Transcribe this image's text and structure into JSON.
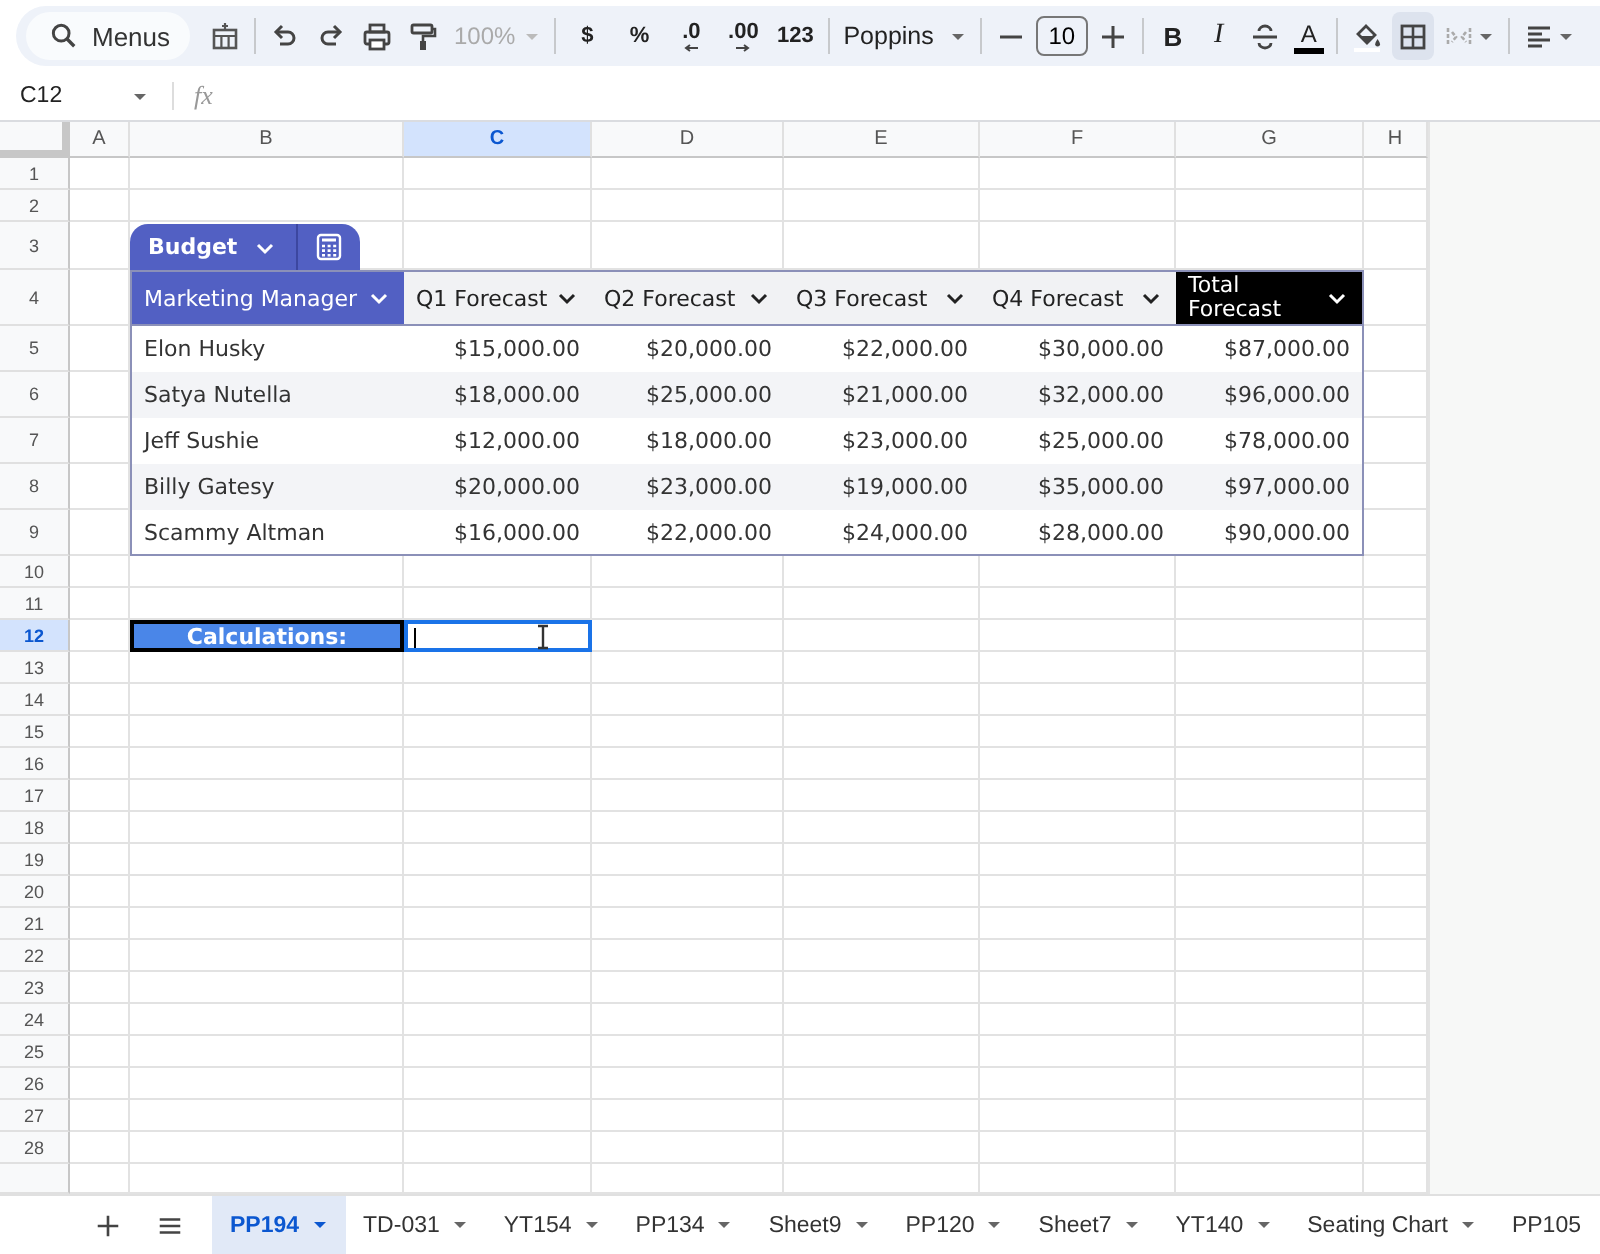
{
  "toolbar": {
    "search": {
      "placeholder": "Menus"
    },
    "zoom": {
      "value": "100%",
      "disabled": true
    },
    "format_buttons": [
      "$",
      "%",
      ".0",
      ".00",
      "123"
    ],
    "font": "Poppins",
    "font_size": "10",
    "bold": "B",
    "italic": "I",
    "text_color": "A",
    "borders": {
      "selected": true
    },
    "merge": {
      "disabled": true
    }
  },
  "formula_bar": {
    "name_box": "C12",
    "fx": "fx"
  },
  "columns": [
    {
      "label": "A",
      "selected": false
    },
    {
      "label": "B",
      "selected": false
    },
    {
      "label": "C",
      "selected": true
    },
    {
      "label": "D",
      "selected": false
    },
    {
      "label": "E",
      "selected": false
    },
    {
      "label": "F",
      "selected": false
    },
    {
      "label": "G",
      "selected": false
    },
    {
      "label": "H",
      "selected": false
    }
  ],
  "rows": [
    {
      "label": "1",
      "selected": false
    },
    {
      "label": "2",
      "selected": false
    },
    {
      "label": "3",
      "selected": false
    },
    {
      "label": "4",
      "selected": false
    },
    {
      "label": "5",
      "selected": false
    },
    {
      "label": "6",
      "selected": false
    },
    {
      "label": "7",
      "selected": false
    },
    {
      "label": "8",
      "selected": false
    },
    {
      "label": "9",
      "selected": false
    },
    {
      "label": "10",
      "selected": false
    },
    {
      "label": "11",
      "selected": false
    },
    {
      "label": "12",
      "selected": true
    },
    {
      "label": "13",
      "selected": false
    },
    {
      "label": "14",
      "selected": false
    },
    {
      "label": "15",
      "selected": false
    },
    {
      "label": "16",
      "selected": false
    },
    {
      "label": "17",
      "selected": false
    },
    {
      "label": "18",
      "selected": false
    },
    {
      "label": "19",
      "selected": false
    },
    {
      "label": "20",
      "selected": false
    },
    {
      "label": "21",
      "selected": false
    },
    {
      "label": "22",
      "selected": false
    },
    {
      "label": "23",
      "selected": false
    },
    {
      "label": "24",
      "selected": false
    },
    {
      "label": "25",
      "selected": false
    },
    {
      "label": "26",
      "selected": false
    },
    {
      "label": "27",
      "selected": false
    },
    {
      "label": "28",
      "selected": false
    }
  ],
  "table": {
    "name": "Budget",
    "headers": [
      {
        "label": "Marketing Manager",
        "kind": "accent"
      },
      {
        "label": "Q1 Forecast",
        "kind": "plain"
      },
      {
        "label": "Q2 Forecast",
        "kind": "plain"
      },
      {
        "label": "Q3 Forecast",
        "kind": "plain"
      },
      {
        "label": "Q4 Forecast",
        "kind": "plain"
      },
      {
        "label": "Total Forecast",
        "kind": "dark"
      }
    ],
    "rows": [
      [
        "Elon Husky",
        "$15,000.00",
        "$20,000.00",
        "$22,000.00",
        "$30,000.00",
        "$87,000.00"
      ],
      [
        "Satya Nutella",
        "$18,000.00",
        "$25,000.00",
        "$21,000.00",
        "$32,000.00",
        "$96,000.00"
      ],
      [
        "Jeff Sushie",
        "$12,000.00",
        "$18,000.00",
        "$23,000.00",
        "$25,000.00",
        "$78,000.00"
      ],
      [
        "Billy Gatesy",
        "$20,000.00",
        "$23,000.00",
        "$19,000.00",
        "$35,000.00",
        "$97,000.00"
      ],
      [
        "Scammy Altman",
        "$16,000.00",
        "$22,000.00",
        "$24,000.00",
        "$28,000.00",
        "$90,000.00"
      ]
    ]
  },
  "calculations_label": "Calculations:",
  "sheet_tabs": [
    {
      "label": "PP194",
      "selected": true,
      "caret": true
    },
    {
      "label": "TD-031",
      "selected": false,
      "caret": true
    },
    {
      "label": "YT154",
      "selected": false,
      "caret": true
    },
    {
      "label": "PP134",
      "selected": false,
      "caret": true
    },
    {
      "label": "Sheet9",
      "selected": false,
      "caret": true
    },
    {
      "label": "PP120",
      "selected": false,
      "caret": true
    },
    {
      "label": "Sheet7",
      "selected": false,
      "caret": true
    },
    {
      "label": "YT140",
      "selected": false,
      "caret": true
    },
    {
      "label": "Seating Chart",
      "selected": false,
      "caret": true
    },
    {
      "label": "PP105",
      "selected": false,
      "caret": false
    }
  ]
}
